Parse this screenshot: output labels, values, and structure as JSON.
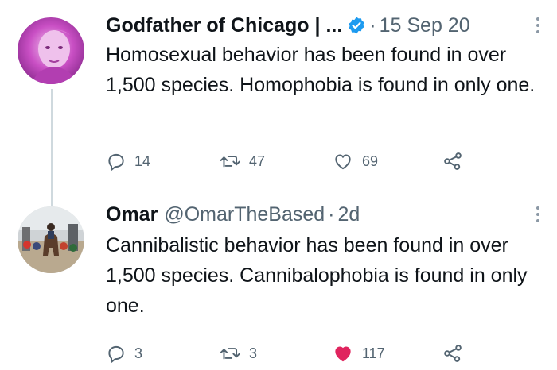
{
  "tweets": [
    {
      "name": "Godfather of Chicago | ...",
      "verified": true,
      "handle": "",
      "time": "15 Sep 20",
      "text": "Homosexual behavior has been found in over 1,500 species. Homophobia is found in only one.",
      "replies": "14",
      "retweets": "47",
      "likes": "69",
      "liked": false
    },
    {
      "name": "Omar",
      "verified": false,
      "handle": "@OmarTheBased",
      "time": "2d",
      "text": "Cannibalistic behavior has been found in over 1,500 species. Cannibalophobia is found in only one.",
      "replies": "3",
      "retweets": "3",
      "likes": "117",
      "liked": true
    }
  ],
  "colors": {
    "text": "#0f1419",
    "muted": "#536471",
    "verified": "#1d9bf0",
    "like_active": "#e0245e",
    "thread_line": "#cfd9de"
  },
  "icons": [
    "reply-icon",
    "retweet-icon",
    "like-icon",
    "share-icon",
    "verified-badge-icon",
    "more-options-icon"
  ]
}
